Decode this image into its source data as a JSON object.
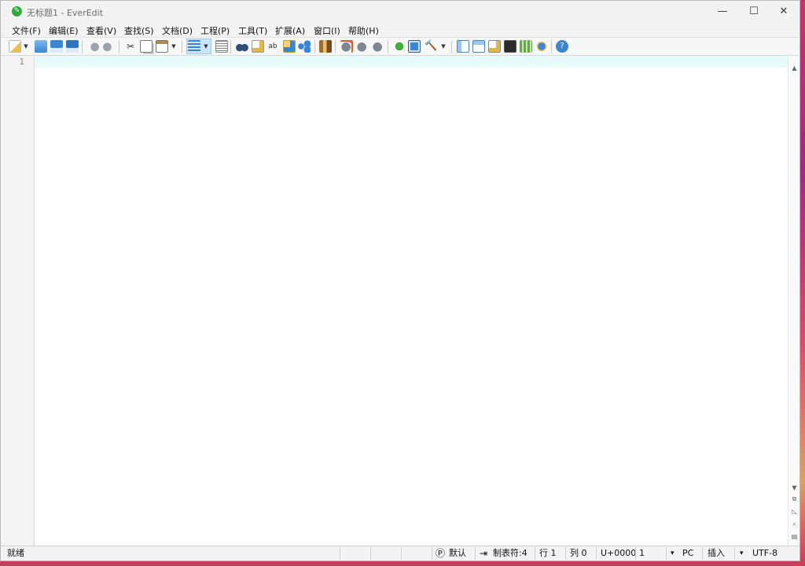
{
  "window": {
    "title": "无标题1 - EverEdit",
    "minimize_glyph": "—",
    "maximize_glyph": "☐",
    "close_glyph": "✕"
  },
  "menu": {
    "items": [
      {
        "label": "文件(F)"
      },
      {
        "label": "编辑(E)"
      },
      {
        "label": "查看(V)"
      },
      {
        "label": "查找(S)"
      },
      {
        "label": "文档(D)"
      },
      {
        "label": "工程(P)"
      },
      {
        "label": "工具(T)"
      },
      {
        "label": "扩展(A)"
      },
      {
        "label": "窗口(I)"
      },
      {
        "label": "帮助(H)"
      }
    ]
  },
  "toolbar": {
    "icons": [
      "new-file-icon",
      "open-folder-icon",
      "save-icon",
      "save-all-icon",
      "undo-icon",
      "redo-icon",
      "cut-icon",
      "copy-icon",
      "paste-icon",
      "word-wrap-icon",
      "document-view-icon",
      "find-icon",
      "find-in-files-icon",
      "replace-icon",
      "find-replace-icon",
      "bookmarks-icon",
      "macro-icon",
      "record-macro-icon",
      "play-macro-icon",
      "stop-macro-icon",
      "plugin-icon",
      "window-icon",
      "tools-icon",
      "sidebar-icon",
      "split-view-icon",
      "snippets-icon",
      "console-icon",
      "output-icon",
      "browser-icon",
      "help-icon"
    ],
    "accent": "#3a86d4"
  },
  "editor": {
    "line_numbers": [
      "1"
    ],
    "content": "",
    "current_line_color": "#e8fbfb"
  },
  "status": {
    "ready": "就绪",
    "scheme_icon": "Ⓟ",
    "scheme": "默认",
    "tab_icon": "⇥",
    "tab": "制表符:4",
    "line": "行 1",
    "column": "列 0",
    "unicode": "U+0000",
    "unicode_value": "1",
    "line_ending_arrow": "▾",
    "line_ending": "PC",
    "mode": "插入",
    "encoding_arrow": "▾",
    "encoding": "UTF-8"
  }
}
